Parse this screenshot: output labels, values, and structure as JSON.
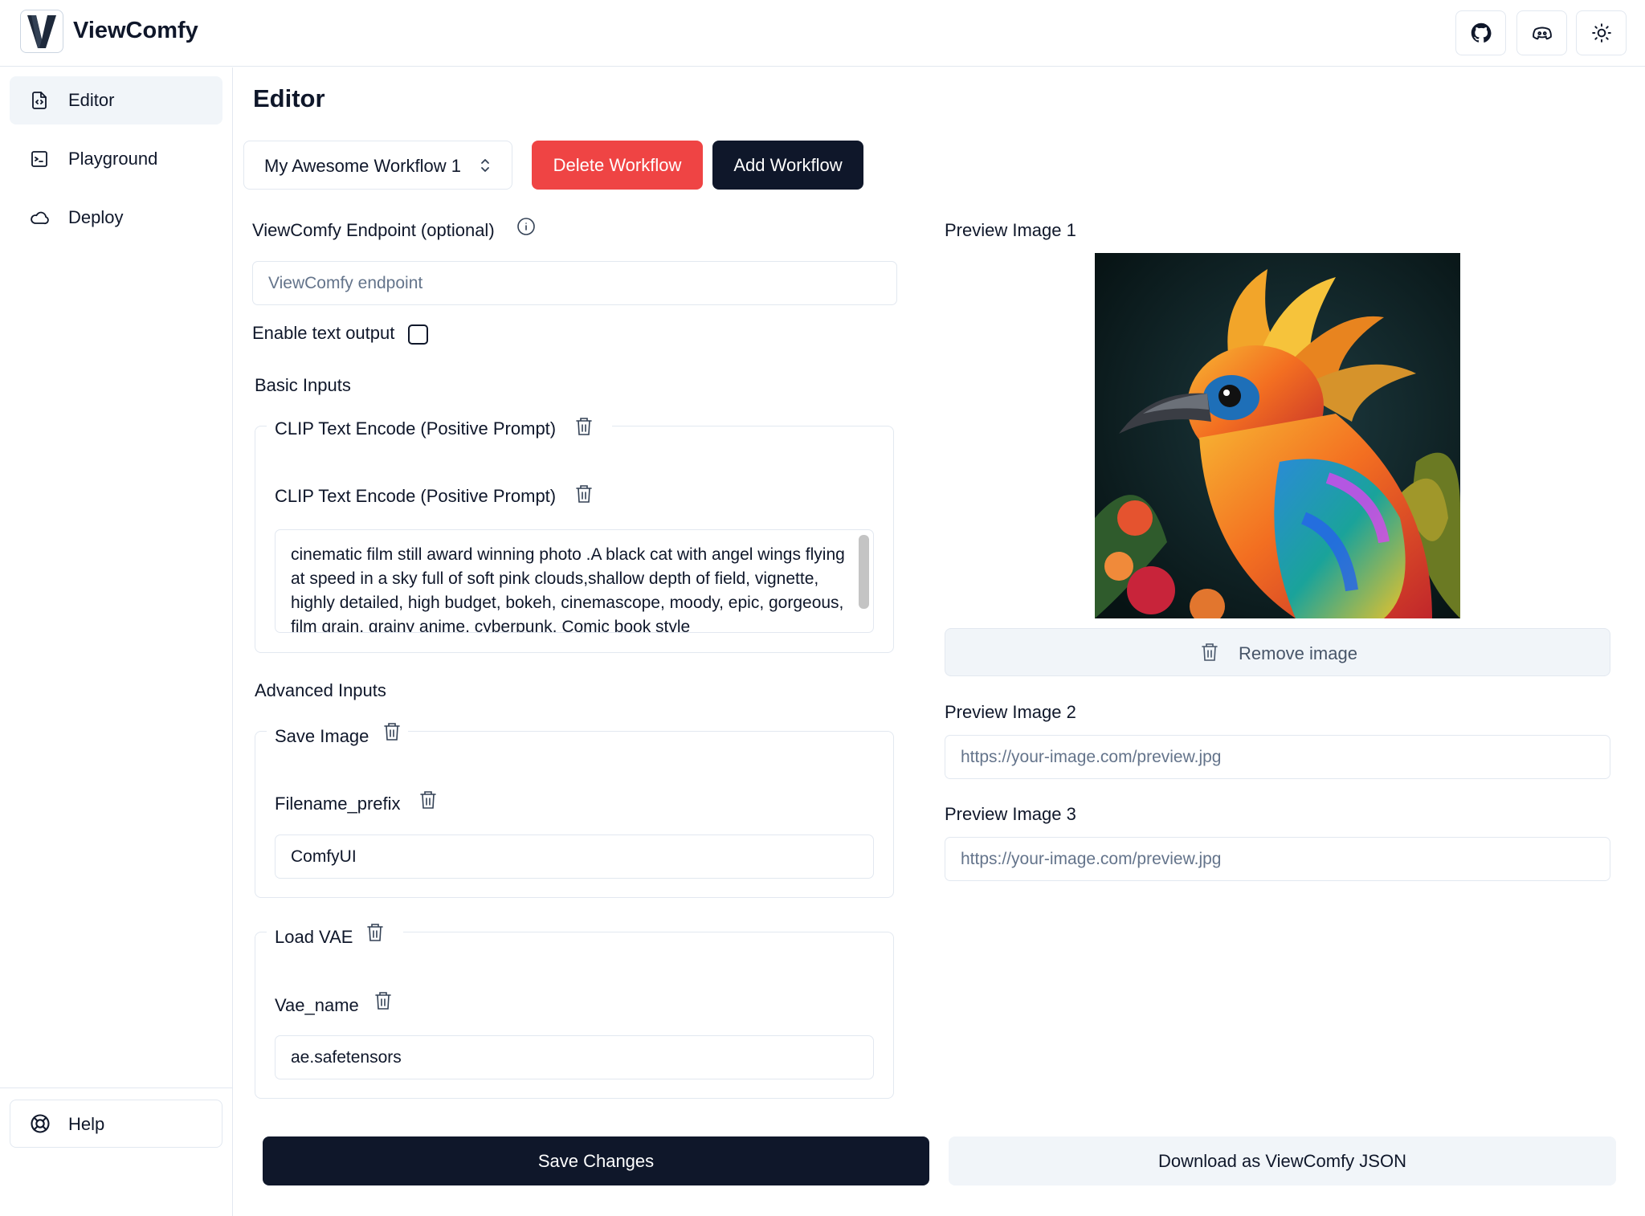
{
  "header": {
    "logo_letter": "V",
    "app_title": "ViewComfy",
    "icons": [
      "github-icon",
      "discord-icon",
      "sun-icon"
    ]
  },
  "sidebar": {
    "items": [
      {
        "label": "Editor",
        "icon": "file-code-icon",
        "active": true
      },
      {
        "label": "Playground",
        "icon": "terminal-square-icon",
        "active": false
      },
      {
        "label": "Deploy",
        "icon": "cloud-icon",
        "active": false
      }
    ],
    "help_label": "Help"
  },
  "main": {
    "title": "Editor",
    "workflow_select": "My Awesome Workflow 1",
    "delete_label": "Delete Workflow",
    "add_label": "Add Workflow",
    "endpoint_label": "ViewComfy Endpoint (optional)",
    "endpoint_placeholder": "ViewComfy endpoint",
    "enable_text_label": "Enable text output",
    "basic_inputs_label": "Basic Inputs",
    "clip_group_title": "CLIP Text Encode (Positive Prompt)",
    "clip_field_label": "CLIP Text Encode (Positive Prompt)",
    "clip_prompt_value": "cinematic film still award winning photo .A black cat with angel wings flying at speed in a sky full of soft pink clouds,shallow depth of field, vignette, highly detailed, high budget, bokeh, cinemascope, moody, epic, gorgeous, film grain, grainy anime, cyberpunk, Comic book style",
    "advanced_inputs_label": "Advanced Inputs",
    "save_image_title": "Save Image",
    "filename_prefix_label": "Filename_prefix",
    "filename_prefix_value": "ComfyUI",
    "load_vae_title": "Load VAE",
    "vae_name_label": "Vae_name",
    "vae_name_value": "ae.safetensors",
    "save_changes_label": "Save Changes",
    "download_label": "Download as ViewComfy JSON"
  },
  "preview": {
    "image1_label": "Preview Image 1",
    "remove_image_label": "Remove image",
    "image2_label": "Preview Image 2",
    "image2_placeholder": "https://your-image.com/preview.jpg",
    "image3_label": "Preview Image 3",
    "image3_placeholder": "https://your-image.com/preview.jpg"
  },
  "colors": {
    "primary": "#0f172a",
    "destructive": "#ef4444",
    "muted": "#f1f5f9",
    "border": "#e2e8f0"
  }
}
